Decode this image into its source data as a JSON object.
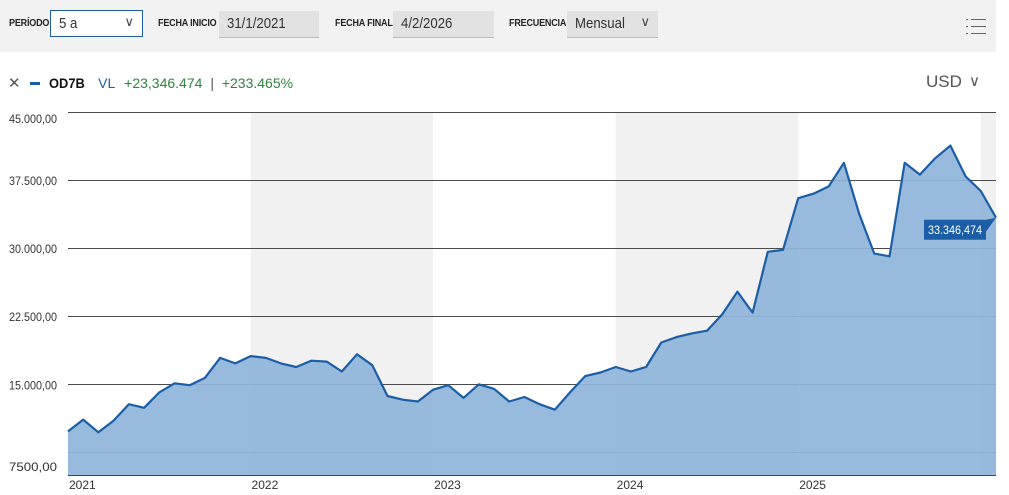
{
  "toolbar": {
    "period_label": "PERÍODO",
    "period_value": "5 a",
    "start_label": "FECHA INICIO",
    "start_value": "31/1/2021",
    "end_label": "FECHA FINAL",
    "end_value": "4/2/2026",
    "frequency_label": "FRECUENCIA",
    "frequency_value": "Mensual",
    "menu_icon": "menu-lines-icon"
  },
  "legend": {
    "close_glyph": "✕",
    "series_name": "OD7B",
    "value_type": "VL",
    "abs_change": "+23,346.474",
    "separator": "|",
    "pct_change": "+233.465%"
  },
  "currency": {
    "label": "USD",
    "icon": "chevron-down-icon"
  },
  "colors": {
    "accent": "#1b5ea6",
    "fill": "#8fb4d9",
    "positive": "#2e8540",
    "band": "#f1f1f1"
  },
  "chart_data": {
    "type": "area",
    "ylim": [
      5000,
      45000
    ],
    "y_ticks": [
      {
        "value": 45000,
        "label": "45.000,00"
      },
      {
        "value": 37500,
        "label": "37.500,00"
      },
      {
        "value": 30000,
        "label": "30.000,00"
      },
      {
        "value": 22500,
        "label": "22.500,00"
      },
      {
        "value": 15000,
        "label": "15.000,00"
      },
      {
        "value": 7500,
        "label": "7500,00"
      }
    ],
    "x_ticks": [
      "2021",
      "2022",
      "2023",
      "2024",
      "2025"
    ],
    "x_start": "2021-01",
    "shaded_years": [
      "2022",
      "2024",
      "2026"
    ],
    "last_value_label": "33.346,474",
    "values": [
      9800,
      11100,
      9700,
      11000,
      12800,
      12400,
      14100,
      15100,
      14900,
      15700,
      17900,
      17300,
      18100,
      17900,
      17300,
      16900,
      17600,
      17500,
      16400,
      18300,
      17100,
      13700,
      13300,
      13100,
      14400,
      14900,
      13500,
      15000,
      14500,
      13100,
      13600,
      12800,
      12200,
      14100,
      15900,
      16300,
      16900,
      16400,
      16900,
      19600,
      20200,
      20600,
      20900,
      22700,
      25200,
      22900,
      29600,
      29800,
      35500,
      36000,
      36800,
      39400,
      33800,
      29400,
      29100,
      39400,
      38100,
      39900,
      41300,
      37900,
      36300,
      33350
    ]
  }
}
